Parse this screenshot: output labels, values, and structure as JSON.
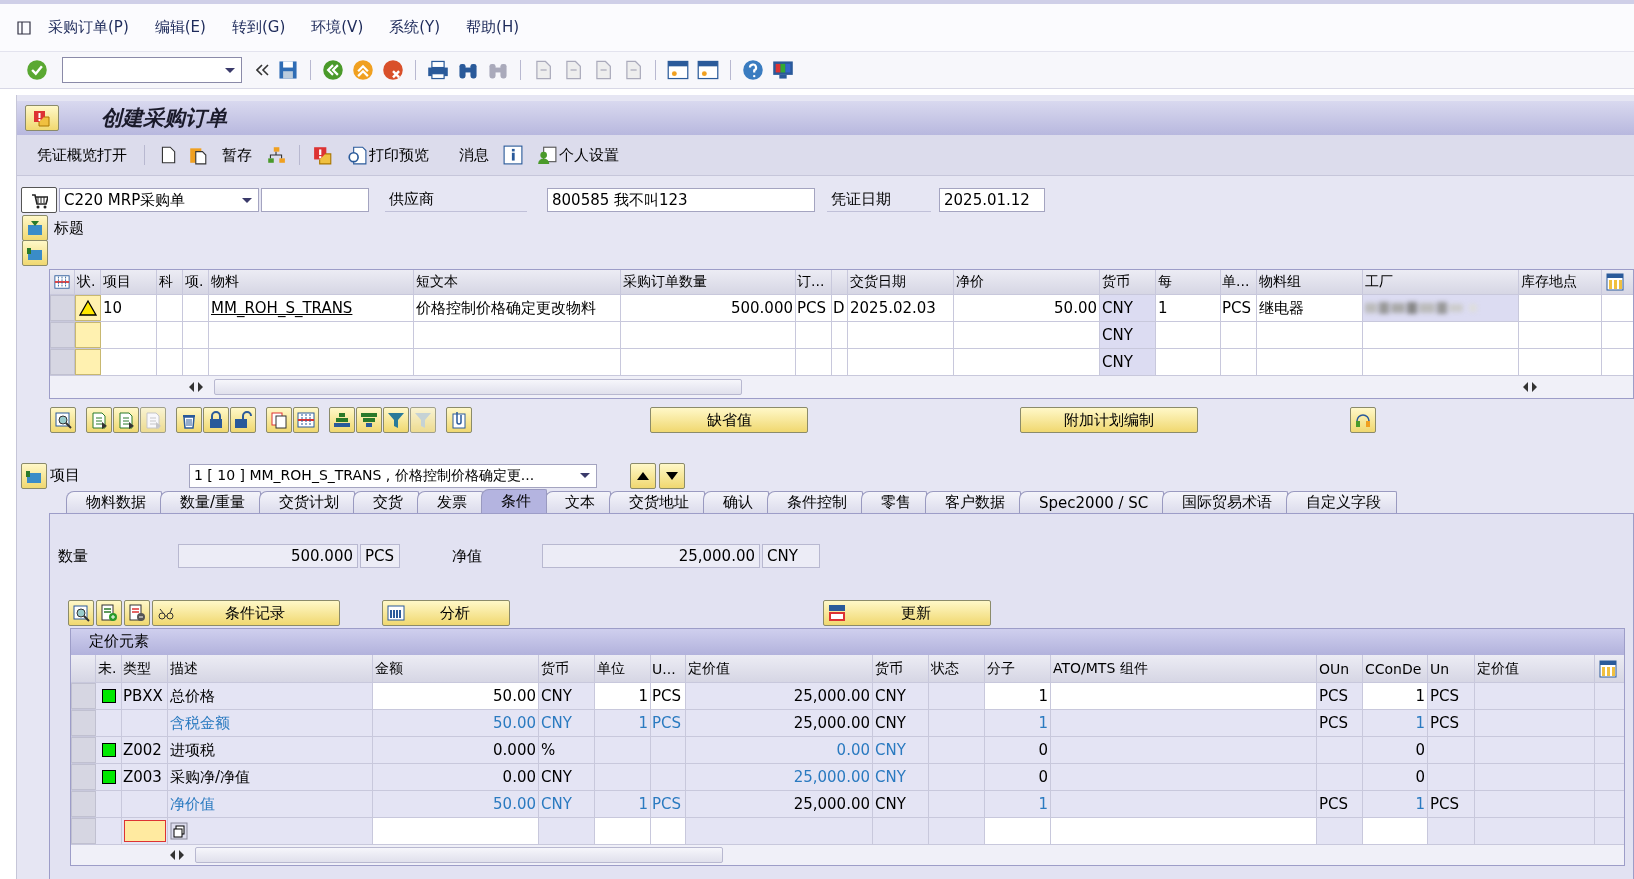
{
  "menu_bar": [
    "采购订单(P)",
    "编辑(E)",
    "转到(G)",
    "环境(V)",
    "系统(Y)",
    "帮助(H)"
  ],
  "title": "创建采购订单",
  "app_toolbar": [
    "凭证概览打开",
    "暂存",
    "打印预览",
    "消息",
    "个人设置"
  ],
  "header": {
    "document_type": "C220 MRP采购单",
    "vendor_label": "供应商",
    "vendor": "800585 我不叫123",
    "date_label": "凭证日期",
    "document_date": "2025.01.12",
    "header_label": "标题"
  },
  "items_table": {
    "columns": [
      "状.",
      "项目",
      "科",
      "项.",
      "物料",
      "短文本",
      "采购订单数量",
      "订...",
      null,
      "交货日期",
      "净价",
      "货币",
      "每",
      "单...",
      "物料组",
      "工厂",
      "库存地点"
    ],
    "rows": [
      {
        "warning": true,
        "plant_blurred": true,
        "cells": [
          null,
          "10",
          null,
          null,
          "MM_ROH_S_TRANS",
          "价格控制价格确定更改物料",
          "500.000",
          "PCS",
          "D",
          "2025.02.03",
          "50.00",
          "CNY",
          "1",
          "PCS",
          "继电器",
          null,
          null
        ]
      },
      {
        "warning": false,
        "plant_blurred": false,
        "cells": [
          null,
          null,
          null,
          null,
          null,
          null,
          null,
          null,
          null,
          null,
          null,
          "CNY",
          null,
          null,
          null,
          null,
          null
        ]
      },
      {
        "warning": false,
        "plant_blurred": false,
        "cells": [
          null,
          null,
          null,
          null,
          null,
          null,
          null,
          null,
          null,
          null,
          null,
          "CNY",
          null,
          null,
          null,
          null,
          null
        ]
      }
    ]
  },
  "item_buttons": [
    "缺省值",
    "附加计划编制"
  ],
  "item_selector": {
    "label": "项目",
    "value": "1 [ 10 ] MM_ROH_S_TRANS , 价格控制价格确定更..."
  },
  "tabs": [
    {
      "label": "物料数据",
      "selected": false
    },
    {
      "label": "数量/重量",
      "selected": false
    },
    {
      "label": "交货计划",
      "selected": false
    },
    {
      "label": "交货",
      "selected": false
    },
    {
      "label": "发票",
      "selected": false
    },
    {
      "label": "条件",
      "selected": true
    },
    {
      "label": "文本",
      "selected": false
    },
    {
      "label": "交货地址",
      "selected": false
    },
    {
      "label": "确认",
      "selected": false
    },
    {
      "label": "条件控制",
      "selected": false
    },
    {
      "label": "零售",
      "selected": false
    },
    {
      "label": "客户数据",
      "selected": false
    },
    {
      "label": "Spec2000 / SC",
      "selected": false
    },
    {
      "label": "国际贸易术语",
      "selected": false
    },
    {
      "label": "自定义字段",
      "selected": false
    }
  ],
  "conditions": {
    "quantity_label": "数量",
    "quantity": "500.000",
    "quantity_unit": "PCS",
    "net_label": "净值",
    "net_value": "25,000.00",
    "net_currency": "CNY",
    "buttons": [
      "条件记录",
      "分析",
      "更新"
    ],
    "pricing": {
      "title": "定价元素",
      "columns": [
        "未.",
        "类型",
        "描述",
        "金额",
        "货币",
        "单位",
        "U...",
        "定价值",
        "货币",
        "状态",
        "分子",
        "ATO/MTS 组件",
        "OUn",
        "CConDe",
        "Un",
        "定价值"
      ],
      "rows": [
        {
          "kind": "condition",
          "active": true,
          "editable": true,
          "subtotal": false,
          "value_highlight": false,
          "cells": [
            null,
            "PBXX",
            "总价格",
            "50.00",
            "CNY",
            "1",
            "PCS",
            "25,000.00",
            "CNY",
            null,
            "1",
            null,
            "PCS",
            "1",
            "PCS",
            null
          ]
        },
        {
          "kind": "condition",
          "active": false,
          "editable": false,
          "subtotal": true,
          "value_highlight": false,
          "cells": [
            null,
            null,
            "含税金额",
            "50.00",
            "CNY",
            "1",
            "PCS",
            "25,000.00",
            "CNY",
            null,
            "1",
            null,
            "PCS",
            "1",
            "PCS",
            null
          ]
        },
        {
          "kind": "condition",
          "active": true,
          "editable": false,
          "subtotal": false,
          "value_highlight": true,
          "cells": [
            null,
            "Z002",
            "进项税",
            "0.000",
            "%",
            null,
            null,
            "0.00",
            "CNY",
            null,
            "0",
            null,
            null,
            "0",
            null,
            null
          ]
        },
        {
          "kind": "condition",
          "active": true,
          "editable": false,
          "subtotal": false,
          "value_highlight": true,
          "cells": [
            null,
            "Z003",
            "采购净/净值",
            "0.00",
            "CNY",
            null,
            null,
            "25,000.00",
            "CNY",
            null,
            "0",
            null,
            null,
            "0",
            null,
            null
          ]
        },
        {
          "kind": "condition",
          "active": false,
          "editable": false,
          "subtotal": true,
          "value_highlight": false,
          "cells": [
            null,
            null,
            "净价值",
            "50.00",
            "CNY",
            "1",
            "PCS",
            "25,000.00",
            "CNY",
            null,
            "1",
            null,
            "PCS",
            "1",
            "PCS",
            null
          ]
        },
        {
          "kind": "entry"
        }
      ]
    }
  }
}
